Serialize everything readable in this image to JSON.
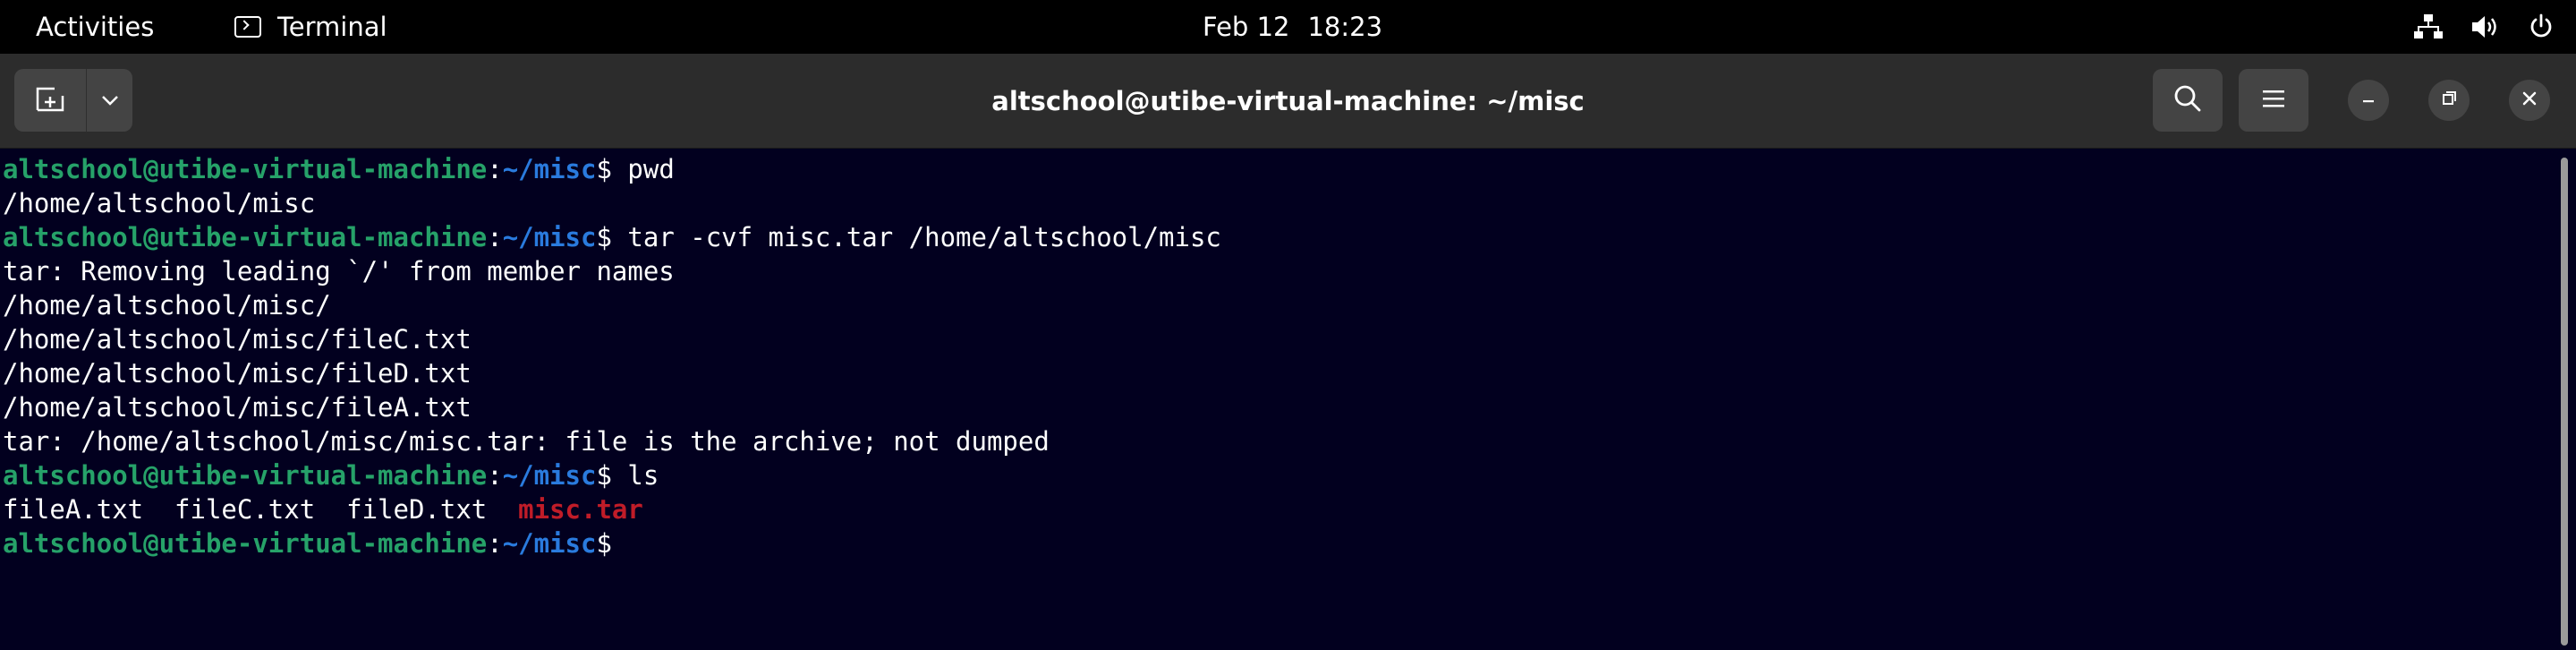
{
  "topbar": {
    "activities": "Activities",
    "app_name": "Terminal",
    "date": "Feb 12",
    "time": "18:23",
    "icons": [
      "network-icon",
      "volume-icon",
      "power-icon"
    ]
  },
  "window": {
    "title": "altschool@utibe-virtual-machine: ~/misc",
    "icons": [
      "new-tab-icon",
      "chevron-down-icon",
      "search-icon",
      "hamburger-menu-icon",
      "minimize-icon",
      "maximize-icon",
      "close-icon"
    ]
  },
  "terminal": {
    "prompt": {
      "user_host": "altschool@utibe-virtual-machine",
      "colon": ":",
      "path": "~/misc",
      "symbol": "$"
    },
    "lines": [
      {
        "type": "prompt",
        "command": " pwd"
      },
      {
        "type": "output",
        "text": "/home/altschool/misc"
      },
      {
        "type": "prompt",
        "command": " tar -cvf misc.tar /home/altschool/misc"
      },
      {
        "type": "output",
        "text": "tar: Removing leading `/' from member names"
      },
      {
        "type": "output",
        "text": "/home/altschool/misc/"
      },
      {
        "type": "output",
        "text": "/home/altschool/misc/fileC.txt"
      },
      {
        "type": "output",
        "text": "/home/altschool/misc/fileD.txt"
      },
      {
        "type": "output",
        "text": "/home/altschool/misc/fileA.txt"
      },
      {
        "type": "output",
        "text": "tar: /home/altschool/misc/misc.tar: file is the archive; not dumped"
      },
      {
        "type": "prompt",
        "command": " ls"
      },
      {
        "type": "ls",
        "plain": "fileA.txt  fileC.txt  fileD.txt  ",
        "archive": "misc.tar"
      },
      {
        "type": "prompt",
        "command": ""
      }
    ]
  },
  "colors": {
    "terminal_bg": "#02001f",
    "user_host": "#26a269",
    "path": "#2a7bde",
    "archive_file": "#c01c28",
    "headerbar_bg": "#2c2c2c",
    "topbar_bg": "#000000"
  }
}
